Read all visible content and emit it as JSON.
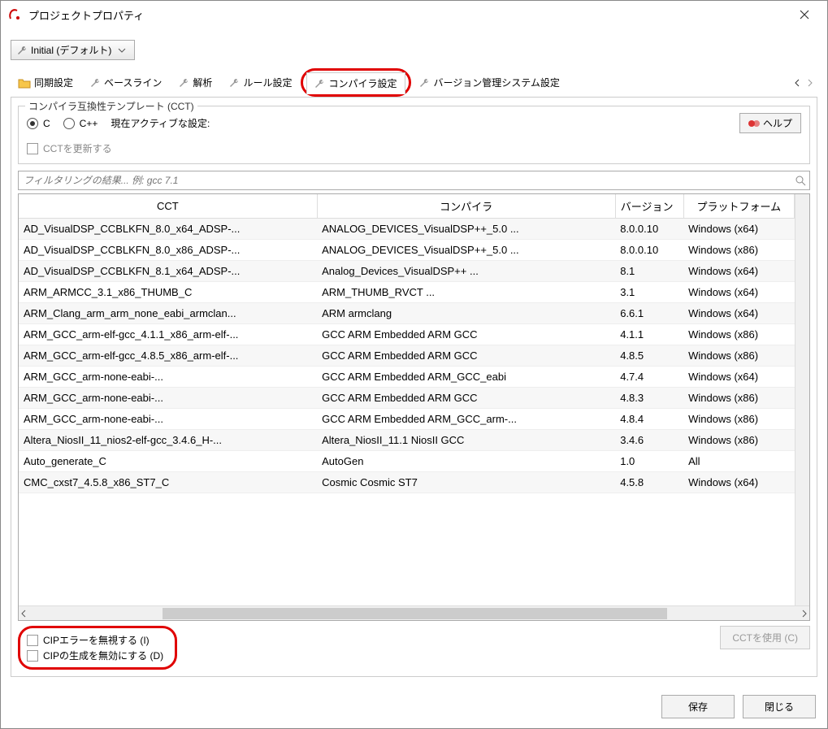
{
  "window": {
    "title": "プロジェクトプロパティ"
  },
  "config_selector": "Initial (デフォルト)",
  "tabs": [
    {
      "label": "同期設定",
      "icon": "folder"
    },
    {
      "label": "ベースライン",
      "icon": "wrench"
    },
    {
      "label": "解析",
      "icon": "wrench"
    },
    {
      "label": "ルール設定",
      "icon": "wrench"
    },
    {
      "label": "コンパイラ設定",
      "icon": "wrench",
      "active": true,
      "highlighted": true
    },
    {
      "label": "バージョン管理システム設定",
      "icon": "wrench"
    }
  ],
  "cct_group": {
    "legend": "コンパイラ互換性テンプレート (CCT)",
    "radio_c": "C",
    "radio_cpp": "C++",
    "active_label": "現在アクティブな設定:",
    "update_label": "CCTを更新する",
    "help_label": "ヘルプ"
  },
  "filter_placeholder": "フィルタリングの結果... 例: gcc 7.1",
  "columns": {
    "cct": "CCT",
    "compiler": "コンパイラ",
    "version": "バージョン",
    "platform": "プラットフォーム"
  },
  "rows": [
    {
      "cct": "AD_VisualDSP_CCBLKFN_8.0_x64_ADSP-...",
      "compiler": "ANALOG_DEVICES_VisualDSP++_5.0 ...",
      "version": "8.0.0.10",
      "platform": "Windows (x64)"
    },
    {
      "cct": "AD_VisualDSP_CCBLKFN_8.0_x86_ADSP-...",
      "compiler": "ANALOG_DEVICES_VisualDSP++_5.0 ...",
      "version": "8.0.0.10",
      "platform": "Windows (x86)"
    },
    {
      "cct": "AD_VisualDSP_CCBLKFN_8.1_x64_ADSP-...",
      "compiler": "Analog_Devices_VisualDSP++ ...",
      "version": "8.1",
      "platform": "Windows (x64)"
    },
    {
      "cct": "ARM_ARMCC_3.1_x86_THUMB_C",
      "compiler": "ARM_THUMB_RVCT ...",
      "version": "3.1",
      "platform": "Windows (x64)"
    },
    {
      "cct": "ARM_Clang_arm_arm_none_eabi_armclan...",
      "compiler": "ARM armclang",
      "version": "6.6.1",
      "platform": "Windows (x64)"
    },
    {
      "cct": "ARM_GCC_arm-elf-gcc_4.1.1_x86_arm-elf-...",
      "compiler": "GCC ARM Embedded ARM GCC",
      "version": "4.1.1",
      "platform": "Windows (x86)"
    },
    {
      "cct": "ARM_GCC_arm-elf-gcc_4.8.5_x86_arm-elf-...",
      "compiler": "GCC ARM Embedded ARM GCC",
      "version": "4.8.5",
      "platform": "Windows (x86)"
    },
    {
      "cct": "ARM_GCC_arm-none-eabi-...",
      "compiler": "GCC ARM Embedded ARM_GCC_eabi",
      "version": "4.7.4",
      "platform": "Windows (x64)"
    },
    {
      "cct": "ARM_GCC_arm-none-eabi-...",
      "compiler": "GCC ARM Embedded ARM GCC",
      "version": "4.8.3",
      "platform": "Windows (x86)"
    },
    {
      "cct": "ARM_GCC_arm-none-eabi-...",
      "compiler": "GCC ARM Embedded ARM_GCC_arm-...",
      "version": "4.8.4",
      "platform": "Windows (x86)"
    },
    {
      "cct": "Altera_NiosII_11_nios2-elf-gcc_3.4.6_H-...",
      "compiler": "Altera_NiosII_11.1 NiosII GCC",
      "version": "3.4.6",
      "platform": "Windows (x86)"
    },
    {
      "cct": "Auto_generate_C",
      "compiler": "AutoGen",
      "version": "1.0",
      "platform": "All"
    },
    {
      "cct": "CMC_cxst7_4.5.8_x86_ST7_C",
      "compiler": "Cosmic Cosmic ST7",
      "version": "4.5.8",
      "platform": "Windows (x64)"
    }
  ],
  "options": {
    "ignore_cip_error": "CIPエラーを無視する (I)",
    "disable_cip_gen": "CIPの生成を無効にする (D)",
    "use_cct": "CCTを使用 (C)"
  },
  "footer": {
    "save": "保存",
    "close": "閉じる"
  }
}
